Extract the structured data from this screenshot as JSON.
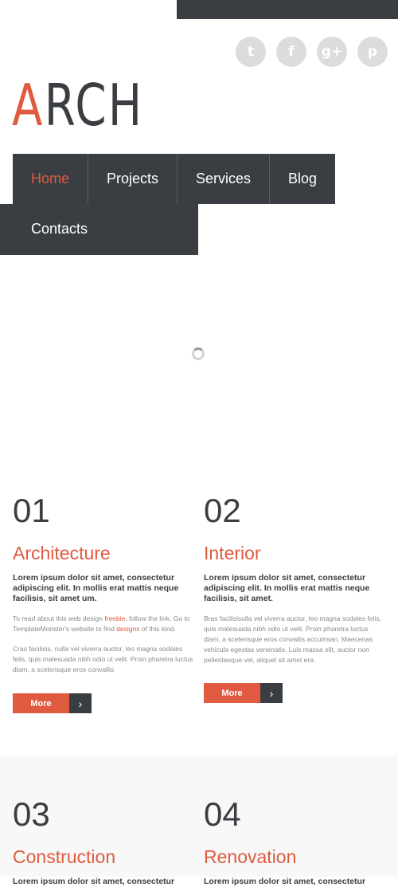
{
  "brand": {
    "logo_accent": "A",
    "logo_rest": "RCH",
    "accent_color": "#e05a3f",
    "dark_color": "#3a3d41"
  },
  "social": [
    {
      "icon": "twitter-icon",
      "glyph": "t"
    },
    {
      "icon": "facebook-icon",
      "glyph": "f"
    },
    {
      "icon": "google-plus-icon",
      "glyph": "g+"
    },
    {
      "icon": "pinterest-icon",
      "glyph": "p"
    }
  ],
  "nav": {
    "items": [
      {
        "label": "Home",
        "active": true
      },
      {
        "label": "Projects"
      },
      {
        "label": "Services"
      },
      {
        "label": "Blog"
      },
      {
        "label": "Contacts"
      }
    ]
  },
  "features": [
    {
      "num": "01",
      "title": "Architecture",
      "lead": "Lorem ipsum dolor sit amet, consectetur adipiscing elit. In mollis erat mattis neque facilisis, sit amet um.",
      "p1_a": "To read about this web design ",
      "p1_link1": "freebie",
      "p1_b": ", follow the link. Go to TemplateMonster's website to find ",
      "p1_link2": "designs",
      "p1_c": " of this kind.",
      "p2": "Cras facilisis, nulla vel viverra auctor, leo magna sodales felis, quis malesuada nibh odio ut velit. Proin pharetra luctus diam, a scelerisque eros convallis",
      "more": "More"
    },
    {
      "num": "02",
      "title": "Interior",
      "lead": "Lorem ipsum dolor sit amet, consectetur adipiscing elit. In mollis erat mattis neque facilisis, sit amet.",
      "p1": "Bras facilisisulla vel viverra auctor, leo magna sodales felis, quis malesuada nibh odio ut velit. Proin pharetra luctus diam, a scelerisque eros convallis accumsan. Maecenas vehicula egestas venenatis. Luis massa elit, auctor non pellentesque vel, aliquet sit amet era.",
      "more": "More"
    },
    {
      "num": "03",
      "title": "Construction",
      "lead": "Lorem ipsum dolor sit amet, consectetur"
    },
    {
      "num": "04",
      "title": "Renovation",
      "lead": "Lorem ipsum dolor sit amet, consectetur"
    }
  ]
}
